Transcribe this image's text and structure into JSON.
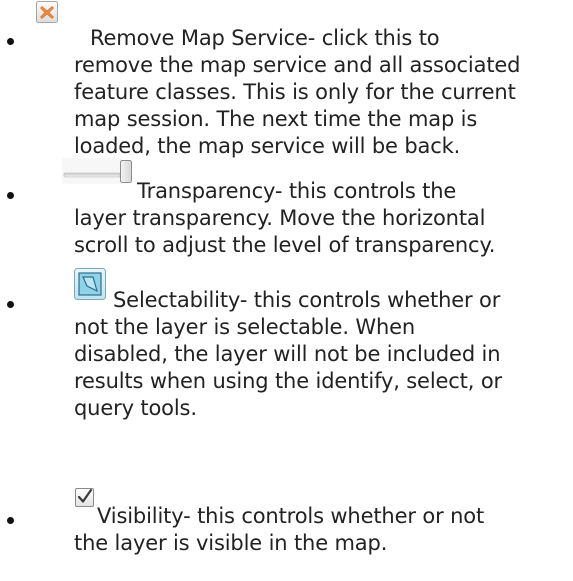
{
  "items": [
    {
      "icon": "remove-map-service-icon",
      "text": "Remove Map Service- click this to\nremove the map service and all associated\nfeature classes. This is only for the current\nmap session.  The next time the map is\nloaded, the map service will be back."
    },
    {
      "icon": "transparency-slider-icon",
      "text": "Transparency- this controls the\nlayer transparency.  Move the horizontal\nscroll to adjust the level of transparency."
    },
    {
      "icon": "selectability-icon",
      "text": " Selectability- this controls whether or\nnot the layer is selectable.  When\ndisabled, the layer will not be included in\nresults when using the identify, select, or\nquery tools."
    },
    {
      "icon": "visibility-checkbox-icon",
      "text": "Visibility- this controls whether or not\nthe layer is visible in the map."
    }
  ],
  "colors": {
    "text": "#222222",
    "remove_icon_accent": "#f08a3c",
    "select_icon_fill": "#8fd3e8"
  }
}
